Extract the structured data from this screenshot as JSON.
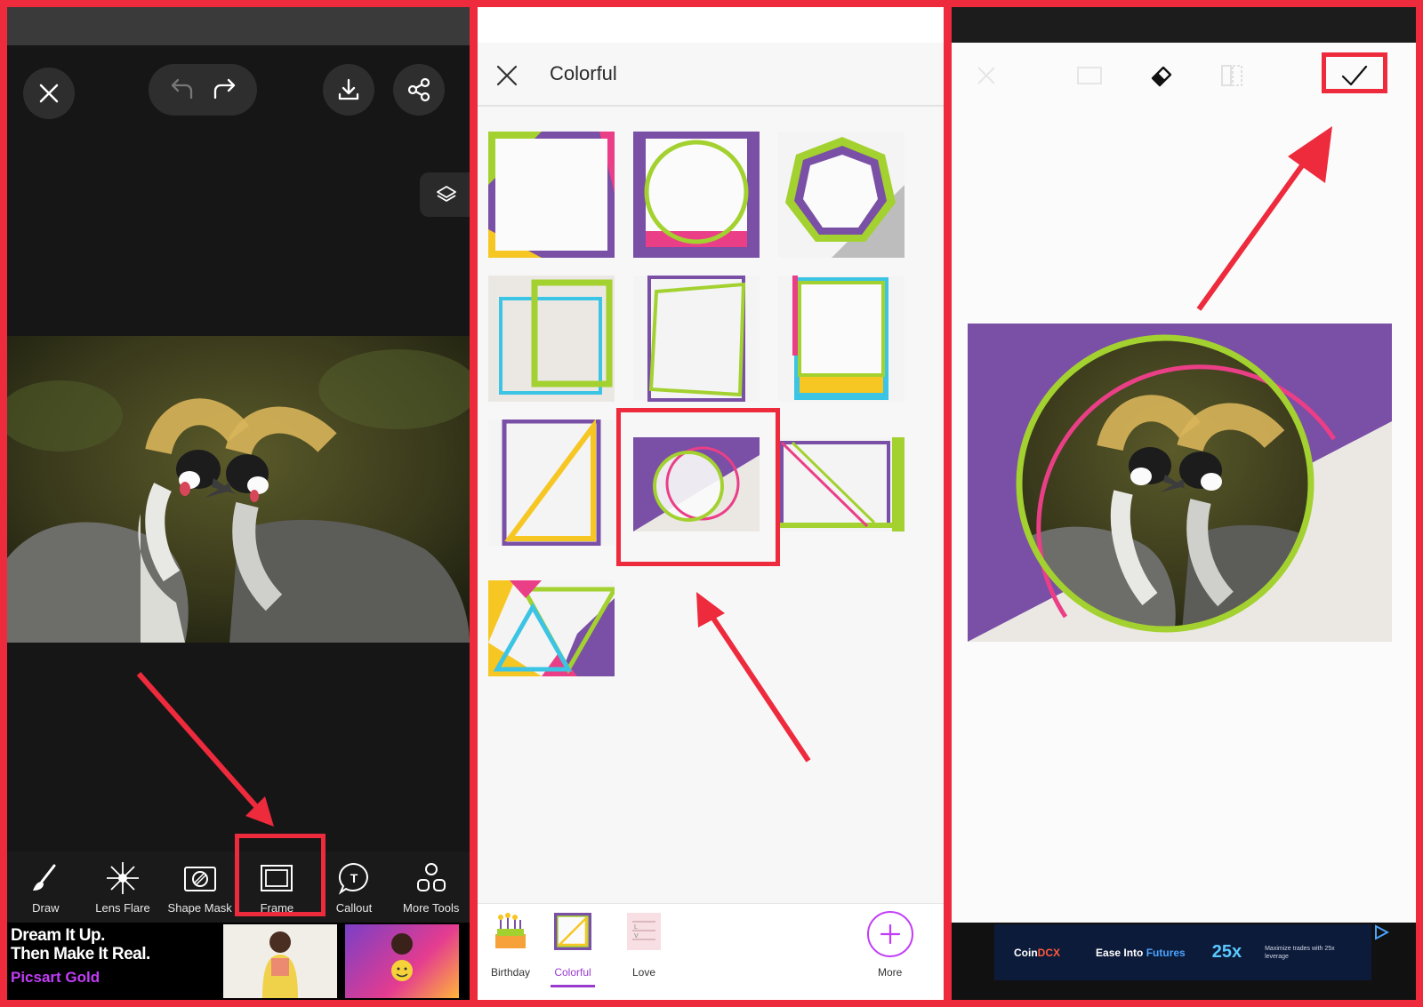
{
  "panel1": {
    "toolbar": [
      {
        "label": "Draw",
        "icon": "brush-icon"
      },
      {
        "label": "Lens Flare",
        "icon": "lens-flare-icon"
      },
      {
        "label": "Shape Mask",
        "icon": "shape-mask-icon"
      },
      {
        "label": "Frame",
        "icon": "frame-icon"
      },
      {
        "label": "Callout",
        "icon": "callout-icon"
      },
      {
        "label": "More Tools",
        "icon": "more-tools-icon"
      }
    ],
    "ad": {
      "headline": "Dream It Up.\nThen Make It Real.",
      "brand": "Picsart Gold"
    }
  },
  "panel2": {
    "title": "Colorful",
    "categories": [
      {
        "label": "Birthday"
      },
      {
        "label": "Colorful"
      },
      {
        "label": "Love"
      }
    ],
    "more_label": "More"
  },
  "panel3": {
    "ad": {
      "brand_a": "Coin",
      "brand_b": "DCX",
      "tag_a": "Ease Into ",
      "tag_b": "Futures",
      "leverage": "25x",
      "fine_print": "Maximize trades with 25x leverage"
    }
  },
  "colors": {
    "highlight": "#ee2a3d",
    "purple": "#7a4fa6",
    "lime": "#a3d12f",
    "pink": "#ea3f86",
    "yellow": "#f6c622",
    "cyan": "#3cc4e4",
    "accent": "#9a3bd0"
  }
}
